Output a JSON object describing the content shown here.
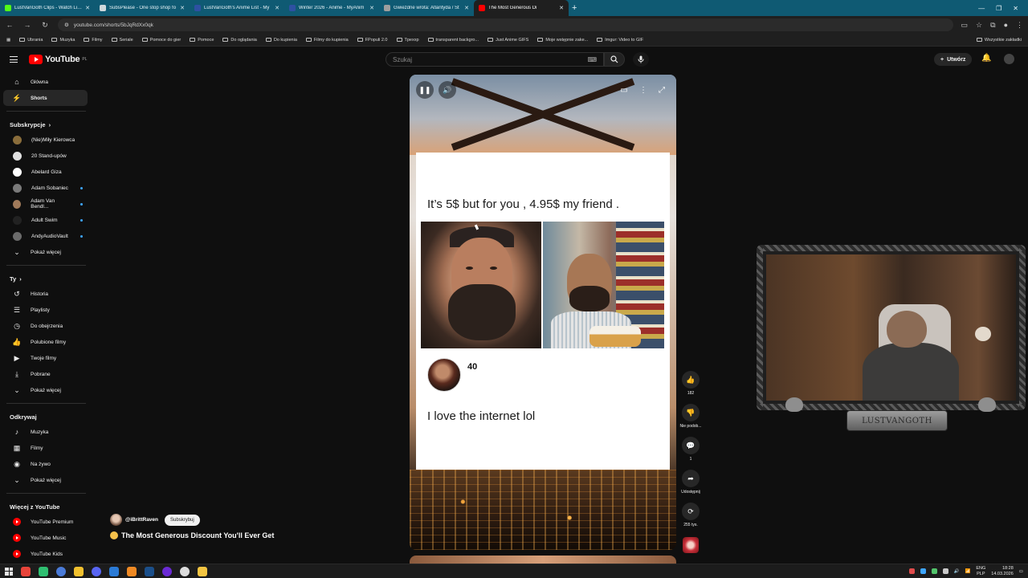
{
  "browser": {
    "tabs": [
      {
        "label": "LustVanGoth Clips - Watch Live",
        "color": "#53fc18",
        "active": false
      },
      {
        "label": "SubsPlease - One stop shop fo",
        "color": "#cfd8dc",
        "active": false
      },
      {
        "label": "LustVanGoth's Anime List - My",
        "color": "#2e51a2",
        "active": false
      },
      {
        "label": "Winter 2026 - Anime - MyAnim",
        "color": "#2e51a2",
        "active": false
      },
      {
        "label": "Gwiezdne wrota: Atlantyda / St",
        "color": "#9e9e9e",
        "active": false
      },
      {
        "label": "The Most Generous Di",
        "color": "#ff0000",
        "active": true
      }
    ],
    "url": "youtube.com/shorts/5bJqRdXx0qk",
    "bookmarks": [
      "Ubrania",
      "Muzyka",
      "Filmy",
      "Seriale",
      "Pomoce do gier",
      "Pomoce",
      "Do oglądania",
      "Do kupienia",
      "Filmy do kupienia",
      "FPopuli 2.0",
      "Tpexxp",
      "transparent backgro...",
      "Just Anime GIFS",
      "Moje wstępnie zake...",
      "Imgur: Video to GIF"
    ],
    "bookmarks_right": "Wszystkie zakładki"
  },
  "header": {
    "logo_text": "YouTube",
    "logo_country": "PL",
    "search_placeholder": "Szukaj",
    "create_label": "Utwórz"
  },
  "sidebar": {
    "main": [
      {
        "label": "Główna",
        "icon": "home-icon",
        "glyph": "⌂",
        "active": false
      },
      {
        "label": "Shorts",
        "icon": "shorts-icon",
        "glyph": "⚡",
        "active": true
      }
    ],
    "subscriptions_title": "Subskrypcje",
    "subscriptions": [
      {
        "label": "(Nie)Miły Kierowca",
        "color": "#8a6d3b",
        "dot": false
      },
      {
        "label": "20 Stand-upów",
        "color": "#e0e0e0",
        "dot": false
      },
      {
        "label": "Abelard Giza",
        "color": "#ffffff",
        "dot": false
      },
      {
        "label": "Adam Sobaniec",
        "color": "#7a7a7a",
        "dot": true
      },
      {
        "label": "Adam Van Bendl...",
        "color": "#a07a5a",
        "dot": true
      },
      {
        "label": "Adult Swim",
        "color": "#222222",
        "dot": true
      },
      {
        "label": "AndyAudioVault",
        "color": "#6b6b6b",
        "dot": true
      }
    ],
    "show_more": "Pokaż więcej",
    "you_title": "Ty",
    "you": [
      {
        "label": "Historia",
        "glyph": "↺"
      },
      {
        "label": "Playlisty",
        "glyph": "☰"
      },
      {
        "label": "Do obejrzenia",
        "glyph": "◷"
      },
      {
        "label": "Polubione filmy",
        "glyph": "👍"
      },
      {
        "label": "Twoje filmy",
        "glyph": "▶"
      },
      {
        "label": "Pobrane",
        "glyph": "⤓"
      }
    ],
    "explore_title": "Odkrywaj",
    "explore": [
      {
        "label": "Muzyka",
        "glyph": "♪"
      },
      {
        "label": "Filmy",
        "glyph": "▦"
      },
      {
        "label": "Na żywo",
        "glyph": "◉"
      }
    ],
    "more_title": "Więcej z YouTube",
    "more": [
      {
        "label": "YouTube Premium"
      },
      {
        "label": "YouTube Music"
      },
      {
        "label": "YouTube Kids"
      }
    ]
  },
  "short": {
    "meme_caption": "It’s 5$ but for you , 4.95$ my friend .",
    "comment_likes": "40",
    "comment_text": "I love the internet lol",
    "creator": "@iBrittRaven",
    "subscribe_label": "Subskrybuj",
    "title": "The Most Generous Discount You'll Ever Get",
    "actions": [
      {
        "name": "like",
        "glyph": "👍",
        "label": "182"
      },
      {
        "name": "dislike",
        "glyph": "👎",
        "label": "Nie podob..."
      },
      {
        "name": "comments",
        "glyph": "💬",
        "label": "1"
      },
      {
        "name": "share",
        "glyph": "➦",
        "label": "Udostępnij"
      },
      {
        "name": "remix",
        "glyph": "⟳",
        "label": "255 tys."
      }
    ]
  },
  "overlay": {
    "cam_label": "LUSTVANGOTH"
  },
  "taskbar": {
    "lang_top": "ENG",
    "lang_bottom": "PLP",
    "time": "18:28",
    "date": "14.03.2026"
  }
}
